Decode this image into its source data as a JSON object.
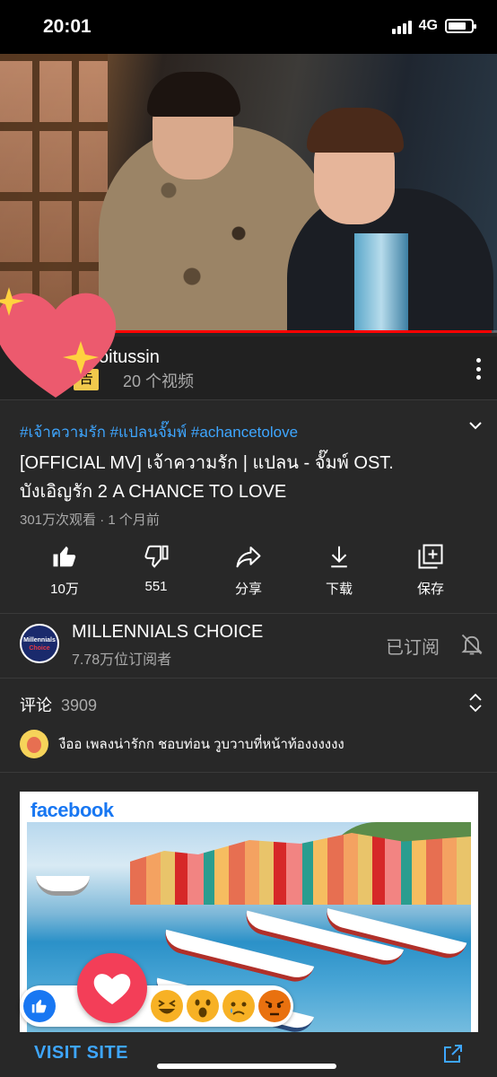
{
  "status_bar": {
    "time": "20:01",
    "network": "4G",
    "battery_level": 0.8
  },
  "video": {
    "progress": 0.99
  },
  "ad_row": {
    "channel": "oitussin",
    "badge": "告",
    "video_count": "20 个视频",
    "more_icon": "more-vert-icon"
  },
  "video_info": {
    "hashtags": "#เจ้าความรัก #แปลนจั๊มพ์ #achancetolove",
    "title": "[OFFICIAL MV] เจ้าความรัก | แปลน - จั๊มพ์ OST. บังเอิญรัก 2 A CHANCE TO LOVE",
    "meta": "301万次观看 · 1 个月前"
  },
  "actions": [
    {
      "icon": "thumbs-up-icon",
      "label": "10万"
    },
    {
      "icon": "thumbs-down-icon",
      "label": "551"
    },
    {
      "icon": "share-icon",
      "label": "分享"
    },
    {
      "icon": "download-icon",
      "label": "下载"
    },
    {
      "icon": "save-playlist-icon",
      "label": "保存"
    }
  ],
  "channel": {
    "name": "MILLENNIALS CHOICE",
    "subscribers": "7.78万位订阅者",
    "subscribed_label": "已订阅",
    "avatar_text_1": "Millennials",
    "avatar_text_2": "Choice"
  },
  "comments": {
    "title": "评论",
    "count": "3909",
    "first_comment": "งืออ เพลงน่ารักก ชอบท่อน วูบวาบที่หน้าท้องงงงงง"
  },
  "facebook_ad": {
    "brand": "facebook",
    "cta": "VISIT SITE",
    "colors": {
      "brand": "#1877f2",
      "love": "#f33e58",
      "like": "#1877f2"
    }
  },
  "colors": {
    "link": "#3ea6ff",
    "background": "#282828",
    "ad_badge": "#f2c94c"
  }
}
